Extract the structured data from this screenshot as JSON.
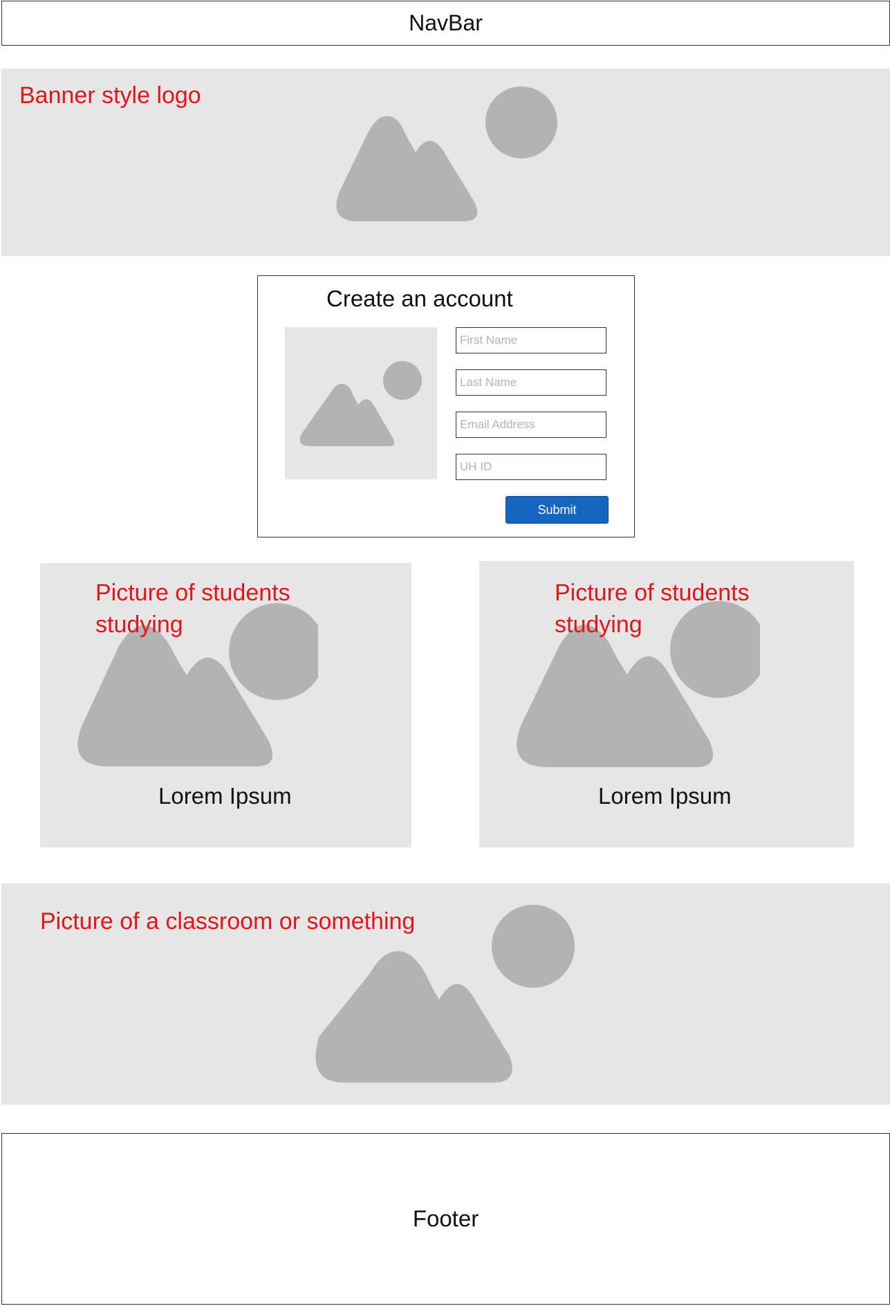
{
  "navbar": {
    "label": "NavBar"
  },
  "banner": {
    "label": "Banner style logo",
    "icon": "image-placeholder-icon"
  },
  "signup": {
    "title": "Create an account",
    "image_icon": "image-placeholder-icon",
    "fields": {
      "first_name_placeholder": "First Name",
      "last_name_placeholder": "Last Name",
      "email_placeholder": "Email Address",
      "uhid_placeholder": "UH ID"
    },
    "submit_label": "Submit"
  },
  "students": [
    {
      "label": "Picture of students\nstudying",
      "caption": "Lorem Ipsum",
      "icon": "image-placeholder-icon"
    },
    {
      "label": "Picture of students\nstudying",
      "caption": "Lorem Ipsum",
      "icon": "image-placeholder-icon"
    }
  ],
  "classroom": {
    "label": "Picture of a classroom or something",
    "icon": "image-placeholder-icon"
  },
  "footer": {
    "label": "Footer"
  },
  "colors": {
    "placeholder_bg": "#e6e6e6",
    "placeholder_shape": "#b3b3b3",
    "annotation_red": "#e0161b",
    "submit_blue": "#1565c0",
    "border": "#333333"
  }
}
